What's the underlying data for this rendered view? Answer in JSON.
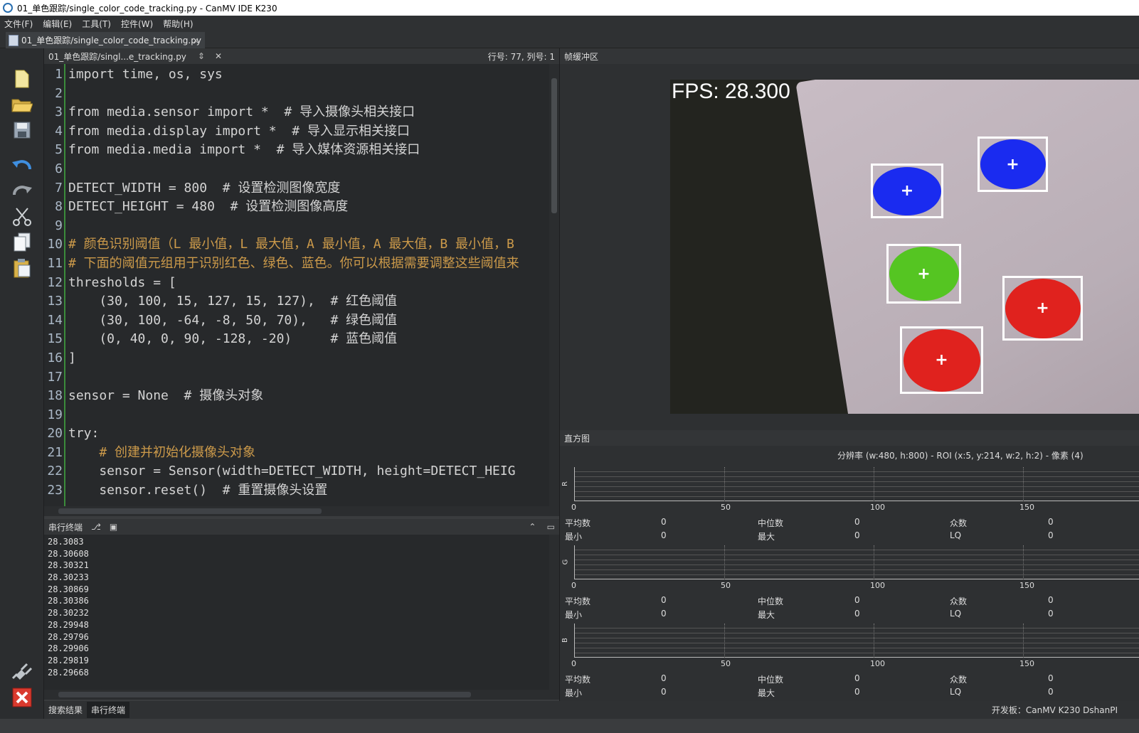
{
  "window": {
    "title": "01_单色跟踪/single_color_code_tracking.py - CanMV IDE K230"
  },
  "menu": [
    "文件(F)",
    "编辑(E)",
    "工具(T)",
    "控件(W)",
    "帮助(H)"
  ],
  "file_tab": {
    "label": "01_单色跟踪/single_color_code_tracking.py",
    "close": "×"
  },
  "editor": {
    "file_name": "01_单色跟踪/singl...e_tracking.py",
    "position": "行号: 77, 列号: 1",
    "line_numbers": [
      "1",
      "2",
      "3",
      "4",
      "5",
      "6",
      "7",
      "8",
      "9",
      "10",
      "11",
      "12",
      "13",
      "14",
      "15",
      "16",
      "17",
      "18",
      "19",
      "20",
      "21",
      "22",
      "23"
    ],
    "code_lines": [
      "import time, os, sys",
      "",
      "from media.sensor import *  # 导入摄像头相关接口",
      "from media.display import *  # 导入显示相关接口",
      "from media.media import *  # 导入媒体资源相关接口",
      "",
      "DETECT_WIDTH = 800  # 设置检测图像宽度",
      "DETECT_HEIGHT = 480  # 设置检测图像高度",
      "",
      "# 颜色识别阈值（L 最小值，L 最大值，A 最小值，A 最大值，B 最小值，B",
      "# 下面的阈值元组用于识别红色、绿色、蓝色。你可以根据需要调整这些阈值来",
      "thresholds = [",
      "    (30, 100, 15, 127, 15, 127),  # 红色阈值",
      "    (30, 100, -64, -8, 50, 70),   # 绿色阈值",
      "    (0, 40, 0, 90, -128, -20)     # 蓝色阈值",
      "]",
      "",
      "sensor = None  # 摄像头对象",
      "",
      "try:",
      "    # 创建并初始化摄像头对象",
      "    sensor = Sensor(width=DETECT_WIDTH, height=DETECT_HEIG",
      "    sensor.reset()  # 重置摄像头设置"
    ]
  },
  "terminal": {
    "title": "串行终端",
    "lines": [
      "28.3083",
      "28.30608",
      "28.30321",
      "28.30233",
      "28.30869",
      "28.30386",
      "28.30232",
      "28.29948",
      "28.29796",
      "28.29906",
      "28.29819",
      "28.29668"
    ]
  },
  "bottom_tabs": [
    "搜索结果",
    "串行终端"
  ],
  "status": {
    "board": "开发板：CanMV K230 DshanPI"
  },
  "framebuffer": {
    "title": "帧缓冲区",
    "fps_text": "FPS: 28.300",
    "blobs": [
      {
        "color": "#1a2bf0"
      },
      {
        "color": "#1a2bf0"
      },
      {
        "color": "#55c522"
      },
      {
        "color": "#e0221e"
      },
      {
        "color": "#e0221e"
      }
    ]
  },
  "histogram": {
    "title": "直方图",
    "info": "分辨率 (w:480, h:800) - ROI (x:5, y:214, w:2, h:2) - 像素 (4)",
    "ticks": [
      "0",
      "50",
      "100",
      "150"
    ],
    "channels": [
      {
        "name": "R",
        "stats": {
          "mean_label": "平均数",
          "mean": "0",
          "median_label": "中位数",
          "median": "0",
          "mode_label": "众数",
          "mode": "0",
          "min_label": "最小",
          "min": "0",
          "max_label": "最大",
          "max": "0",
          "lq_label": "LQ",
          "lq": "0"
        }
      },
      {
        "name": "G",
        "stats": {
          "mean_label": "平均数",
          "mean": "0",
          "median_label": "中位数",
          "median": "0",
          "mode_label": "众数",
          "mode": "0",
          "min_label": "最小",
          "min": "0",
          "max_label": "最大",
          "max": "0",
          "lq_label": "LQ",
          "lq": "0"
        }
      },
      {
        "name": "B",
        "stats": {
          "mean_label": "平均数",
          "mean": "0",
          "median_label": "中位数",
          "median": "0",
          "mode_label": "众数",
          "mode": "0",
          "min_label": "最小",
          "min": "0",
          "max_label": "最大",
          "max": "0",
          "lq_label": "LQ",
          "lq": "0"
        }
      }
    ]
  }
}
